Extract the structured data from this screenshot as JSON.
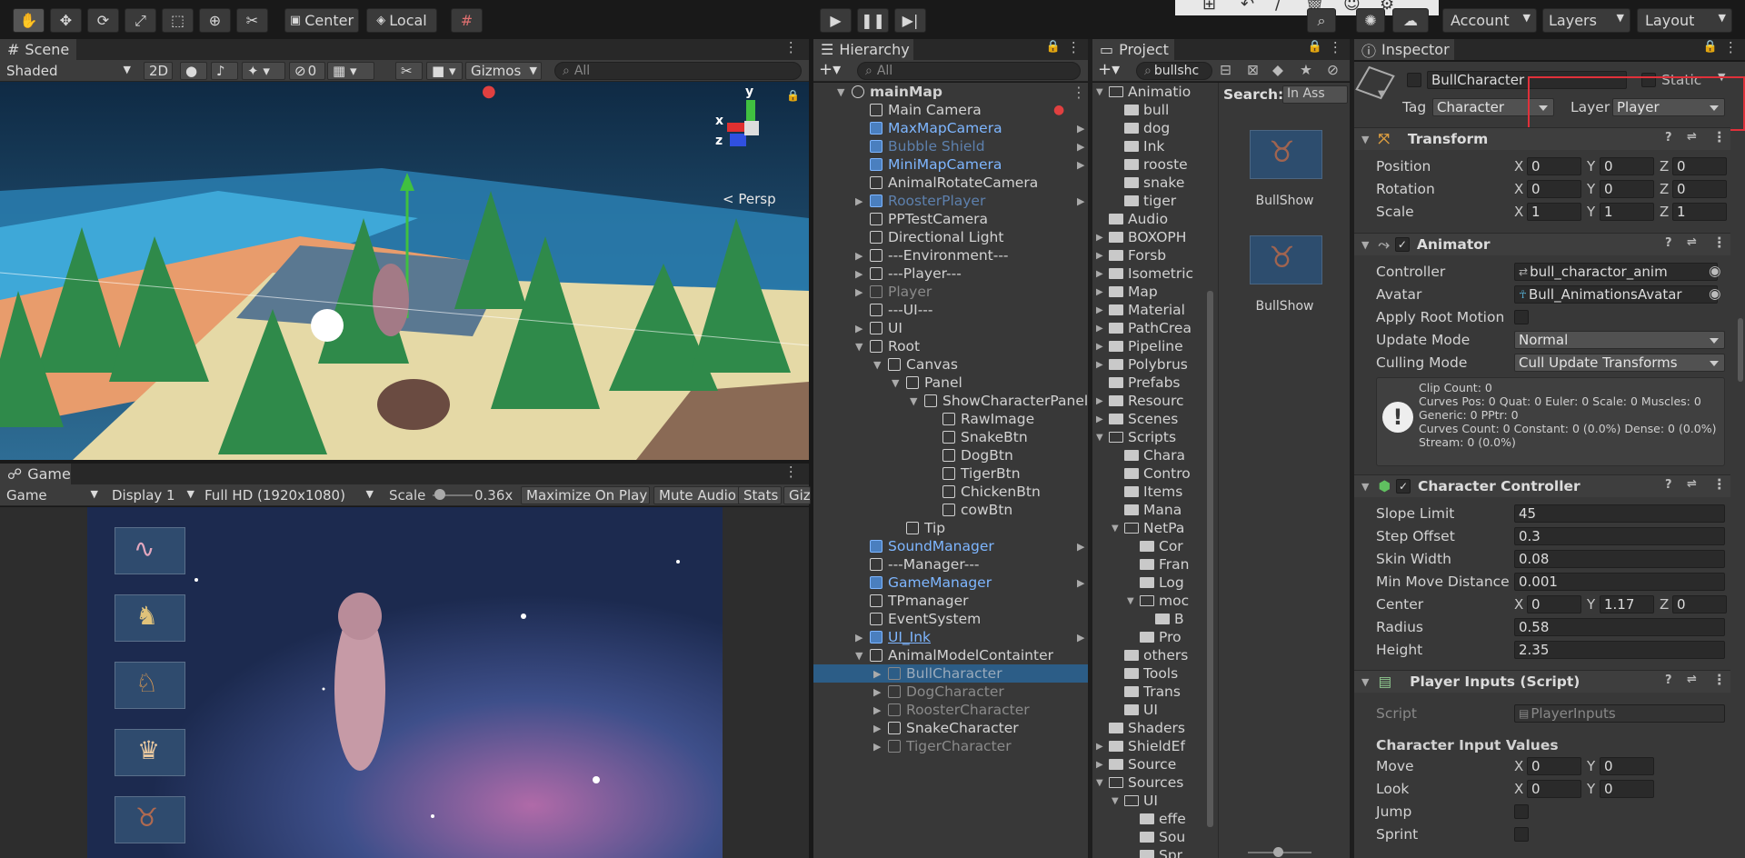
{
  "toolbar": {
    "pivot_label": "Center",
    "space_label": "Local",
    "account_label": "Account",
    "layers_label": "Layers",
    "layout_label": "Layout"
  },
  "scene": {
    "tab_label": "Scene",
    "shading": "Shaded",
    "mode_2d": "2D",
    "hidden_count": "0",
    "gizmos": "Gizmos",
    "search_placeholder": "All",
    "persp_label": "Persp",
    "axis_y": "y",
    "axis_x": "x",
    "axis_z": "z"
  },
  "game": {
    "tab_label": "Game",
    "view": "Game",
    "display": "Display 1",
    "resolution": "Full HD (1920x1080)",
    "scale_label": "Scale",
    "scale_value": "0.36x",
    "maximize": "Maximize On Play",
    "mute": "Mute Audio",
    "stats": "Stats",
    "giz": "Giz"
  },
  "hierarchy": {
    "tab_label": "Hierarchy",
    "search_placeholder": "All",
    "rows": [
      {
        "label": "mainMap",
        "indent": 0,
        "style": "bold",
        "arrow": "down",
        "icon": "unity"
      },
      {
        "label": "Main Camera",
        "indent": 1,
        "style": "normal",
        "arrow": "",
        "icon": "cube"
      },
      {
        "label": "MaxMapCamera",
        "indent": 1,
        "style": "blue",
        "arrow": "",
        "icon": "prefab",
        "right": true
      },
      {
        "label": "Bubble Shield",
        "indent": 1,
        "style": "blue-dim",
        "arrow": "",
        "icon": "prefab",
        "right": true
      },
      {
        "label": "MiniMapCamera",
        "indent": 1,
        "style": "blue",
        "arrow": "",
        "icon": "prefab",
        "right": true
      },
      {
        "label": "AnimalRotateCamera",
        "indent": 1,
        "style": "normal",
        "arrow": "",
        "icon": "cube"
      },
      {
        "label": "RoosterPlayer",
        "indent": 1,
        "style": "blue-dim",
        "arrow": "right",
        "icon": "prefab",
        "right": true
      },
      {
        "label": "PPTestCamera",
        "indent": 1,
        "style": "normal",
        "arrow": "",
        "icon": "cube"
      },
      {
        "label": "Directional Light",
        "indent": 1,
        "style": "normal",
        "arrow": "",
        "icon": "cube"
      },
      {
        "label": "---Environment---",
        "indent": 1,
        "style": "normal",
        "arrow": "right",
        "icon": "cube"
      },
      {
        "label": "---Player---",
        "indent": 1,
        "style": "normal",
        "arrow": "right",
        "icon": "cube"
      },
      {
        "label": "Player",
        "indent": 1,
        "style": "dim",
        "arrow": "right",
        "icon": "cube"
      },
      {
        "label": "---UI---",
        "indent": 1,
        "style": "normal",
        "arrow": "",
        "icon": "cube"
      },
      {
        "label": "UI",
        "indent": 1,
        "style": "normal",
        "arrow": "right",
        "icon": "cube"
      },
      {
        "label": "Root",
        "indent": 1,
        "style": "normal",
        "arrow": "down",
        "icon": "cube"
      },
      {
        "label": "Canvas",
        "indent": 2,
        "style": "normal",
        "arrow": "down",
        "icon": "cube"
      },
      {
        "label": "Panel",
        "indent": 3,
        "style": "normal",
        "arrow": "down",
        "icon": "cube"
      },
      {
        "label": "ShowCharacterPanel",
        "indent": 4,
        "style": "normal",
        "arrow": "down",
        "icon": "cube"
      },
      {
        "label": "RawImage",
        "indent": 5,
        "style": "normal",
        "arrow": "",
        "icon": "cube"
      },
      {
        "label": "SnakeBtn",
        "indent": 5,
        "style": "normal",
        "arrow": "",
        "icon": "cube"
      },
      {
        "label": "DogBtn",
        "indent": 5,
        "style": "normal",
        "arrow": "",
        "icon": "cube"
      },
      {
        "label": "TigerBtn",
        "indent": 5,
        "style": "normal",
        "arrow": "",
        "icon": "cube"
      },
      {
        "label": "ChickenBtn",
        "indent": 5,
        "style": "normal",
        "arrow": "",
        "icon": "cube"
      },
      {
        "label": "cowBtn",
        "indent": 5,
        "style": "normal",
        "arrow": "",
        "icon": "cube"
      },
      {
        "label": "Tip",
        "indent": 3,
        "style": "normal",
        "arrow": "",
        "icon": "cube"
      },
      {
        "label": "SoundManager",
        "indent": 1,
        "style": "blue",
        "arrow": "",
        "icon": "prefab",
        "right": true
      },
      {
        "label": "---Manager---",
        "indent": 1,
        "style": "normal",
        "arrow": "",
        "icon": "cube"
      },
      {
        "label": "GameManager",
        "indent": 1,
        "style": "blue",
        "arrow": "",
        "icon": "prefab",
        "right": true
      },
      {
        "label": "TPmanager",
        "indent": 1,
        "style": "normal",
        "arrow": "",
        "icon": "cube"
      },
      {
        "label": "EventSystem",
        "indent": 1,
        "style": "normal",
        "arrow": "",
        "icon": "cube"
      },
      {
        "label": "UI_Ink",
        "indent": 1,
        "style": "blue-u",
        "arrow": "right",
        "icon": "prefab",
        "right": true
      },
      {
        "label": "AnimalModelContainter",
        "indent": 1,
        "style": "normal",
        "arrow": "down",
        "icon": "cube"
      },
      {
        "label": "BullCharacter",
        "indent": 2,
        "style": "dim",
        "arrow": "right",
        "icon": "cube",
        "selected": true
      },
      {
        "label": "DogCharacter",
        "indent": 2,
        "style": "dim",
        "arrow": "right",
        "icon": "cube"
      },
      {
        "label": "RoosterCharacter",
        "indent": 2,
        "style": "dim",
        "arrow": "right",
        "icon": "cube"
      },
      {
        "label": "SnakeCharacter",
        "indent": 2,
        "style": "normal",
        "arrow": "right",
        "icon": "cube"
      },
      {
        "label": "TigerCharacter",
        "indent": 2,
        "style": "dim",
        "arrow": "right",
        "icon": "cube"
      }
    ]
  },
  "project": {
    "tab_label": "Project",
    "search_value": "bullshc",
    "search_label": "Search:",
    "in_assets": "In Ass",
    "folders": [
      {
        "label": "Animatio",
        "indent": 1,
        "open": true
      },
      {
        "label": "bull",
        "indent": 2
      },
      {
        "label": "dog",
        "indent": 2
      },
      {
        "label": "Ink",
        "indent": 2
      },
      {
        "label": "rooste",
        "indent": 2
      },
      {
        "label": "snake",
        "indent": 2
      },
      {
        "label": "tiger",
        "indent": 2
      },
      {
        "label": "Audio",
        "indent": 1
      },
      {
        "label": "BOXOPH",
        "indent": 1,
        "arrow": true
      },
      {
        "label": "Forsb",
        "indent": 1,
        "arrow": true
      },
      {
        "label": "Isometric",
        "indent": 1,
        "arrow": true
      },
      {
        "label": "Map",
        "indent": 1,
        "arrow": true
      },
      {
        "label": "Material",
        "indent": 1,
        "arrow": true
      },
      {
        "label": "PathCrea",
        "indent": 1,
        "arrow": true
      },
      {
        "label": "Pipeline",
        "indent": 1,
        "arrow": true
      },
      {
        "label": "Polybrus",
        "indent": 1,
        "arrow": true
      },
      {
        "label": "Prefabs",
        "indent": 1
      },
      {
        "label": "Resourc",
        "indent": 1,
        "arrow": true
      },
      {
        "label": "Scenes",
        "indent": 1,
        "arrow": true
      },
      {
        "label": "Scripts",
        "indent": 1,
        "open": true
      },
      {
        "label": "Chara",
        "indent": 2
      },
      {
        "label": "Contro",
        "indent": 2
      },
      {
        "label": "Items",
        "indent": 2
      },
      {
        "label": "Mana",
        "indent": 2
      },
      {
        "label": "NetPa",
        "indent": 2,
        "open": true
      },
      {
        "label": "Cor",
        "indent": 3
      },
      {
        "label": "Fran",
        "indent": 3
      },
      {
        "label": "Log",
        "indent": 3
      },
      {
        "label": "moc",
        "indent": 3,
        "open": true
      },
      {
        "label": "B",
        "indent": 4
      },
      {
        "label": "Pro",
        "indent": 3
      },
      {
        "label": "others",
        "indent": 2
      },
      {
        "label": "Tools",
        "indent": 2
      },
      {
        "label": "Trans",
        "indent": 2
      },
      {
        "label": "UI",
        "indent": 2
      },
      {
        "label": "Shaders",
        "indent": 1
      },
      {
        "label": "ShieldEf",
        "indent": 1,
        "arrow": true
      },
      {
        "label": "Source",
        "indent": 1,
        "arrow": true
      },
      {
        "label": "Sources",
        "indent": 1,
        "open": true
      },
      {
        "label": "UI",
        "indent": 2,
        "open": true
      },
      {
        "label": "effe",
        "indent": 3
      },
      {
        "label": "Sou",
        "indent": 3
      },
      {
        "label": "Spr",
        "indent": 3
      }
    ],
    "assets": [
      "BullShow",
      "BullShow"
    ]
  },
  "inspector": {
    "tab_label": "Inspector",
    "object_name": "BullCharacter",
    "static_label": "Static",
    "tag_label": "Tag",
    "tag_value": "Character",
    "layer_label": "Layer",
    "layer_value": "Player",
    "transform": {
      "title": "Transform",
      "position_label": "Position",
      "rotation_label": "Rotation",
      "scale_label": "Scale",
      "pos": [
        "0",
        "0",
        "0"
      ],
      "rot": [
        "0",
        "0",
        "0"
      ],
      "scl": [
        "1",
        "1",
        "1"
      ]
    },
    "animator": {
      "title": "Animator",
      "controller_label": "Controller",
      "controller_value": "bull_charactor_anim",
      "avatar_label": "Avatar",
      "avatar_value": "Bull_AnimationsAvatar",
      "root_motion_label": "Apply Root Motion",
      "update_mode_label": "Update Mode",
      "update_mode_value": "Normal",
      "culling_label": "Culling Mode",
      "culling_value": "Cull Update Transforms",
      "info_lines": [
        "Clip Count: 0",
        "Curves Pos: 0 Quat: 0 Euler: 0 Scale: 0 Muscles: 0",
        "Generic: 0 PPtr: 0",
        "Curves Count: 0 Constant: 0 (0.0%) Dense: 0 (0.0%)",
        "Stream: 0 (0.0%)"
      ]
    },
    "char_controller": {
      "title": "Character Controller",
      "slope_label": "Slope Limit",
      "slope": "45",
      "step_label": "Step Offset",
      "step": "0.3",
      "skin_label": "Skin Width",
      "skin": "0.08",
      "minmove_label": "Min Move Distance",
      "minmove": "0.001",
      "center_label": "Center",
      "center": [
        "0",
        "1.17",
        "0"
      ],
      "radius_label": "Radius",
      "radius": "0.58",
      "height_label": "Height",
      "height": "2.35"
    },
    "player_inputs": {
      "title": "Player Inputs (Script)",
      "script_label": "Script",
      "script_value": "PlayerInputs",
      "section_label": "Character Input Values",
      "move_label": "Move",
      "move": [
        "0",
        "0"
      ],
      "look_label": "Look",
      "look": [
        "0",
        "0"
      ],
      "jump_label": "Jump",
      "sprint_label": "Sprint"
    }
  },
  "colors": {
    "highlight_box": "#e0303a",
    "selection": "#2c5d87",
    "prefab_blue": "#7eb6ff"
  }
}
